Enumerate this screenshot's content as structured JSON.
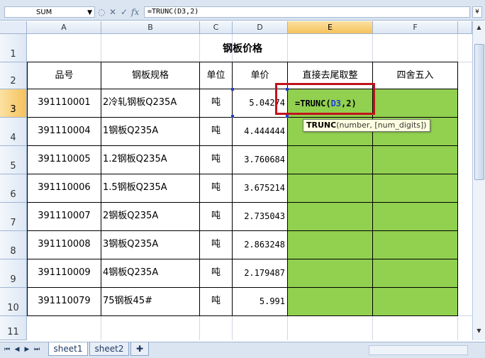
{
  "formula_bar": {
    "name_box": "SUM",
    "formula": "=TRUNC(D3,2)"
  },
  "columns": [
    "A",
    "B",
    "C",
    "D",
    "E",
    "F"
  ],
  "rows": [
    "1",
    "2",
    "3",
    "4",
    "5",
    "6",
    "7",
    "8",
    "9",
    "10",
    "11"
  ],
  "sheet": {
    "title": "钢板价格",
    "headers": [
      "品号",
      "钢板规格",
      "单位",
      "单价",
      "直接去尾取整",
      "四舍五入"
    ],
    "data": [
      [
        "391110001",
        "2冷轧钢板Q235A",
        "吨",
        "5.04274"
      ],
      [
        "391110004",
        "1钢板Q235A",
        "吨",
        "4.444444"
      ],
      [
        "391110005",
        "1.2钢板Q235A",
        "吨",
        "3.760684"
      ],
      [
        "391110006",
        "1.5钢板Q235A",
        "吨",
        "3.675214"
      ],
      [
        "391110007",
        "2钢板Q235A",
        "吨",
        "2.735043"
      ],
      [
        "391110008",
        "3钢板Q235A",
        "吨",
        "2.863248"
      ],
      [
        "391110009",
        "4钢板Q235A",
        "吨",
        "2.179487"
      ],
      [
        "391110079",
        "75钢板45#",
        "吨",
        "5.991"
      ]
    ]
  },
  "editing": {
    "prefix": "=TRUNC(",
    "ref": "D3",
    "suffix": ",2)"
  },
  "tooltip": {
    "func": "TRUNC",
    "args": "(number, [num_digits])"
  },
  "tabs": [
    "sheet1",
    "sheet2"
  ],
  "colors": {
    "fill_green": "#92d050",
    "highlight_red": "#c0141d",
    "ref_blue": "#1f3fd6"
  }
}
